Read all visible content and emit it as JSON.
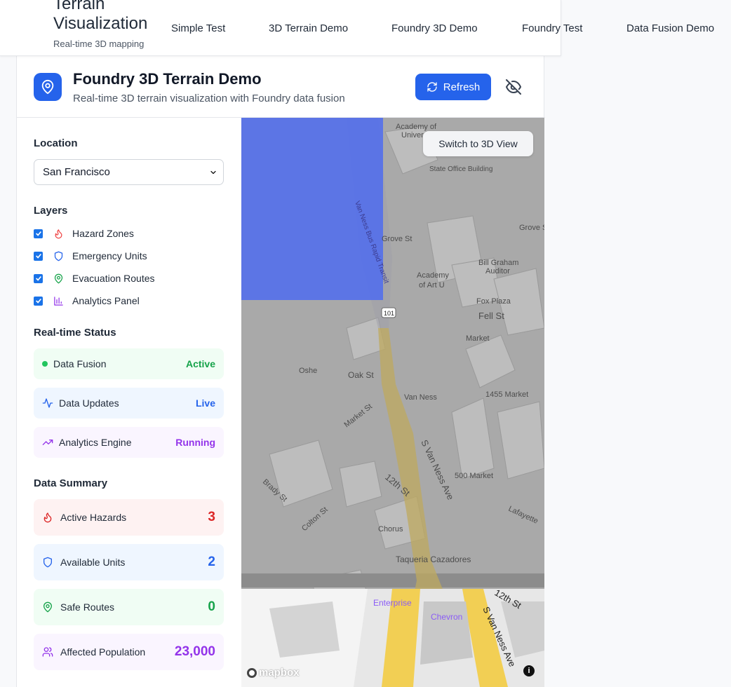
{
  "brand": {
    "title": "Terrain Visualization",
    "subtitle": "Real-time 3D mapping"
  },
  "nav": [
    {
      "label": "Simple Test"
    },
    {
      "label": "3D Terrain Demo"
    },
    {
      "label": "Foundry 3D Demo"
    },
    {
      "label": "Foundry Test"
    },
    {
      "label": "Data Fusion Demo"
    }
  ],
  "header": {
    "title": "Foundry 3D Terrain Demo",
    "subtitle": "Real-time 3D terrain visualization with Foundry data fusion",
    "refresh_label": "Refresh"
  },
  "sidebar": {
    "location": {
      "title": "Location",
      "value": "San Francisco"
    },
    "layers": {
      "title": "Layers",
      "items": [
        {
          "label": "Hazard Zones",
          "checked": true,
          "icon": "flame-icon",
          "color": "#ef4444"
        },
        {
          "label": "Emergency Units",
          "checked": true,
          "icon": "shield-icon",
          "color": "#2563eb"
        },
        {
          "label": "Evacuation Routes",
          "checked": true,
          "icon": "map-pin-icon",
          "color": "#16a34a"
        },
        {
          "label": "Analytics Panel",
          "checked": true,
          "icon": "bar-chart-icon",
          "color": "#9333ea"
        }
      ]
    },
    "status": {
      "title": "Real-time Status",
      "items": [
        {
          "label": "Data Fusion",
          "value": "Active",
          "bg": "#f0fdf4",
          "color": "#16a34a"
        },
        {
          "label": "Data Updates",
          "value": "Live",
          "bg": "#eff6ff",
          "color": "#2563eb"
        },
        {
          "label": "Analytics Engine",
          "value": "Running",
          "bg": "#faf5ff",
          "color": "#9333ea"
        }
      ]
    },
    "summary": {
      "title": "Data Summary",
      "items": [
        {
          "label": "Active Hazards",
          "value": "3",
          "bg": "#fef2f2",
          "color": "#dc2626"
        },
        {
          "label": "Available Units",
          "value": "2",
          "bg": "#eff6ff",
          "color": "#2563eb"
        },
        {
          "label": "Safe Routes",
          "value": "0",
          "bg": "#f0fdf4",
          "color": "#16a34a"
        },
        {
          "label": "Affected Population",
          "value": "23,000",
          "bg": "#faf5ff",
          "color": "#9333ea"
        }
      ]
    }
  },
  "map": {
    "switch_label": "Switch to 3D View",
    "logo_text": "mapbox",
    "attribution_icon": "i",
    "labels": [
      "Academy of University",
      "Grove St",
      "Academy of Art U",
      "Bill Graham Auditorium",
      "Fox Plaza",
      "Fell St",
      "Oak St",
      "Van Ness",
      "1455 Market",
      "Market St",
      "S Van Ness Ave",
      "12th St",
      "500 Market",
      "Chorus",
      "Taqueria Cazadores",
      "Colton St",
      "Brady St",
      "Enterprise",
      "Chevron",
      "12th St",
      "S Van Ness Ave",
      "Van Ness Bus Rapid Transit",
      "State Office Building",
      "Lafayette",
      "Oshe",
      "101"
    ]
  }
}
